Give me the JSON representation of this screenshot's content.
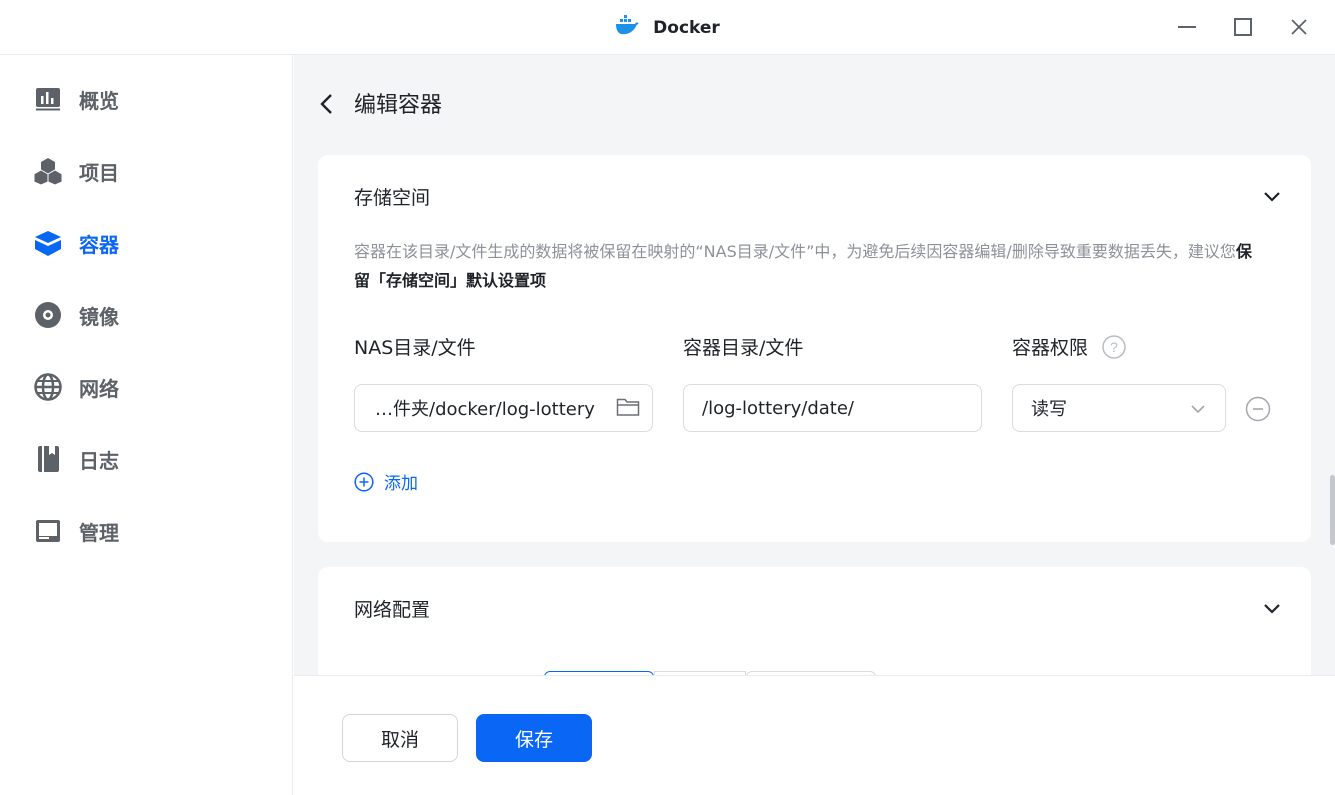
{
  "window": {
    "title": "Docker",
    "controls": [
      "minimize-icon",
      "maximize-icon",
      "close-icon"
    ]
  },
  "sidebar": {
    "active_color": "#0a66f5",
    "items": [
      {
        "label": "概览",
        "icon": "overview-chart-icon",
        "active": false
      },
      {
        "label": "项目",
        "icon": "project-cubes-icon",
        "active": false
      },
      {
        "label": "容器",
        "icon": "container-box-icon",
        "active": true
      },
      {
        "label": "镜像",
        "icon": "image-disc-icon",
        "active": false
      },
      {
        "label": "网络",
        "icon": "network-globe-icon",
        "active": false
      },
      {
        "label": "日志",
        "icon": "log-book-icon",
        "active": false
      },
      {
        "label": "管理",
        "icon": "management-monitor-icon",
        "active": false
      }
    ]
  },
  "page": {
    "title": "编辑容器"
  },
  "storage": {
    "title": "存储空间",
    "desc_prefix": "容器在该目录/文件生成的数据将被保留在映射的“NAS目录/文件”中，为避免后续因容器编辑/删除导致重要数据丢失，建议您",
    "desc_bold": "保留「存储空间」默认设置项",
    "col_nas": "NAS目录/文件",
    "col_container": "容器目录/文件",
    "col_permission": "容器权限",
    "row": {
      "nas_path": "…件夹/docker/log-lottery",
      "container_path": "/log-lottery/date/",
      "permission": "读写"
    },
    "add_label": "添加"
  },
  "network": {
    "title": "网络配置"
  },
  "footer": {
    "cancel_label": "取消",
    "save_label": "保存"
  }
}
